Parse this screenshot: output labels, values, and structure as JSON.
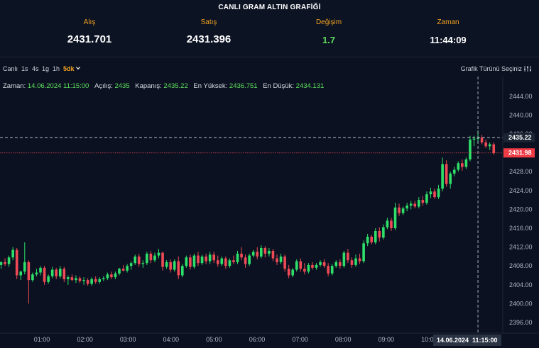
{
  "header": {
    "title": "CANLI GRAM ALTIN GRAFİĞİ",
    "stats": [
      {
        "label": "Alış",
        "value": "2431.701"
      },
      {
        "label": "Satış",
        "value": "2431.396"
      },
      {
        "label": "Değişim",
        "value": "1.7"
      },
      {
        "label": "Zaman",
        "value": "11:44:09"
      }
    ]
  },
  "toolbar": {
    "intervals": [
      "Canlı",
      "1s",
      "4s",
      "1g",
      "1h",
      "5dk"
    ],
    "active_interval": "5dk",
    "chart_type_label": "Grafik Türünü Seçiniz"
  },
  "ohlc_info": {
    "time_label": "Zaman:",
    "time_value": "14.06.2024 11:15:00",
    "open_label": "Açılış:",
    "open_value": "2435",
    "close_label": "Kapanış:",
    "close_value": "2435.22",
    "high_label": "En Yüksek:",
    "high_value": "2436.751",
    "low_label": "En Düşük:",
    "low_value": "2434.131"
  },
  "crosshair": {
    "price_label": "2435.22",
    "time_label": "11:15:00",
    "date_label": "14.06.2024"
  },
  "last_price_label": "2431.98",
  "colors": {
    "up": "#2ee06a",
    "down": "#ef4a56",
    "accent": "#f0a020",
    "background": "#0b1120"
  },
  "chart_data": {
    "type": "candlestick",
    "y_ticks": [
      2396,
      2400,
      2404,
      2408,
      2412,
      2416,
      2420,
      2424,
      2428,
      2432,
      2436,
      2440,
      2444
    ],
    "ylim": [
      2395,
      2446
    ],
    "x_ticks": [
      "01:00",
      "02:00",
      "03:00",
      "04:00",
      "05:00",
      "06:00",
      "07:00",
      "08:00",
      "09:00",
      "10:00",
      "11:00"
    ],
    "grid": false,
    "candles": [
      [
        2408.2,
        2409.0,
        2407.4,
        2408.8
      ],
      [
        2408.8,
        2409.6,
        2408.0,
        2408.4
      ],
      [
        2408.4,
        2410.2,
        2407.8,
        2409.8
      ],
      [
        2409.8,
        2412.0,
        2409.2,
        2411.4
      ],
      [
        2411.4,
        2411.8,
        2405.2,
        2406.0
      ],
      [
        2406.0,
        2407.0,
        2405.0,
        2406.8
      ],
      [
        2406.8,
        2413.0,
        2406.2,
        2408.8
      ],
      [
        2408.8,
        2409.2,
        2400.0,
        2405.0
      ],
      [
        2405.0,
        2406.6,
        2404.6,
        2406.2
      ],
      [
        2406.2,
        2407.4,
        2405.8,
        2406.6
      ],
      [
        2406.6,
        2408.0,
        2406.0,
        2407.6
      ],
      [
        2407.6,
        2408.0,
        2404.0,
        2404.6
      ],
      [
        2404.6,
        2406.2,
        2404.2,
        2405.8
      ],
      [
        2405.8,
        2407.8,
        2405.4,
        2407.2
      ],
      [
        2407.2,
        2407.6,
        2405.2,
        2405.8
      ],
      [
        2405.8,
        2408.0,
        2405.4,
        2407.4
      ],
      [
        2407.4,
        2407.8,
        2404.6,
        2405.2
      ],
      [
        2405.2,
        2406.0,
        2404.0,
        2405.6
      ],
      [
        2405.6,
        2406.2,
        2404.8,
        2405.0
      ],
      [
        2405.0,
        2406.0,
        2404.4,
        2405.4
      ],
      [
        2405.4,
        2405.8,
        2404.4,
        2404.8
      ],
      [
        2404.8,
        2405.6,
        2404.0,
        2405.0
      ],
      [
        2405.0,
        2405.4,
        2403.8,
        2404.2
      ],
      [
        2404.2,
        2405.6,
        2403.8,
        2405.2
      ],
      [
        2405.2,
        2405.8,
        2404.2,
        2404.6
      ],
      [
        2404.6,
        2405.6,
        2404.2,
        2405.2
      ],
      [
        2405.2,
        2405.8,
        2404.8,
        2405.4
      ],
      [
        2405.4,
        2406.6,
        2405.0,
        2406.2
      ],
      [
        2406.2,
        2406.8,
        2405.2,
        2405.6
      ],
      [
        2405.6,
        2406.8,
        2405.2,
        2406.4
      ],
      [
        2406.4,
        2407.6,
        2406.0,
        2407.4
      ],
      [
        2407.4,
        2408.2,
        2406.8,
        2407.0
      ],
      [
        2407.0,
        2408.4,
        2406.6,
        2408.0
      ],
      [
        2408.0,
        2409.0,
        2407.2,
        2408.6
      ],
      [
        2408.6,
        2410.4,
        2408.2,
        2410.0
      ],
      [
        2410.0,
        2410.6,
        2407.8,
        2408.4
      ],
      [
        2408.4,
        2409.2,
        2407.6,
        2408.6
      ],
      [
        2408.6,
        2411.0,
        2408.2,
        2410.6
      ],
      [
        2410.6,
        2411.2,
        2408.6,
        2409.2
      ],
      [
        2409.2,
        2410.8,
        2408.8,
        2410.2
      ],
      [
        2410.2,
        2411.6,
        2409.6,
        2410.8
      ],
      [
        2410.8,
        2411.0,
        2407.0,
        2407.8
      ],
      [
        2407.8,
        2409.2,
        2407.4,
        2408.8
      ],
      [
        2408.8,
        2409.4,
        2406.6,
        2407.2
      ],
      [
        2407.2,
        2409.4,
        2406.8,
        2409.0
      ],
      [
        2409.0,
        2410.0,
        2405.2,
        2406.0
      ],
      [
        2406.0,
        2408.4,
        2405.6,
        2408.0
      ],
      [
        2408.0,
        2410.2,
        2407.6,
        2409.8
      ],
      [
        2409.8,
        2410.4,
        2407.2,
        2407.8
      ],
      [
        2407.8,
        2410.6,
        2407.4,
        2410.2
      ],
      [
        2410.2,
        2411.0,
        2408.0,
        2408.6
      ],
      [
        2408.6,
        2410.4,
        2408.2,
        2410.0
      ],
      [
        2410.0,
        2410.6,
        2408.4,
        2409.0
      ],
      [
        2409.0,
        2411.0,
        2408.4,
        2410.4
      ],
      [
        2410.4,
        2411.0,
        2408.6,
        2409.2
      ],
      [
        2409.2,
        2410.2,
        2407.8,
        2408.4
      ],
      [
        2408.4,
        2410.0,
        2408.0,
        2409.6
      ],
      [
        2409.6,
        2410.0,
        2407.4,
        2408.0
      ],
      [
        2408.0,
        2409.6,
        2407.6,
        2409.2
      ],
      [
        2409.2,
        2410.2,
        2408.4,
        2408.8
      ],
      [
        2408.8,
        2411.2,
        2408.4,
        2410.6
      ],
      [
        2410.6,
        2412.0,
        2409.2,
        2409.8
      ],
      [
        2409.8,
        2410.4,
        2407.6,
        2408.4
      ],
      [
        2408.4,
        2410.6,
        2408.0,
        2410.2
      ],
      [
        2410.2,
        2411.4,
        2409.8,
        2411.0
      ],
      [
        2411.0,
        2412.0,
        2409.4,
        2410.0
      ],
      [
        2410.0,
        2412.4,
        2409.6,
        2411.8
      ],
      [
        2411.8,
        2412.2,
        2409.8,
        2410.6
      ],
      [
        2410.6,
        2411.8,
        2410.0,
        2411.2
      ],
      [
        2411.2,
        2411.6,
        2409.0,
        2409.6
      ],
      [
        2409.6,
        2410.4,
        2408.2,
        2408.8
      ],
      [
        2408.8,
        2410.6,
        2408.4,
        2410.0
      ],
      [
        2410.0,
        2410.4,
        2406.8,
        2407.4
      ],
      [
        2407.4,
        2408.2,
        2405.4,
        2406.0
      ],
      [
        2406.0,
        2407.6,
        2405.6,
        2407.2
      ],
      [
        2407.2,
        2409.4,
        2406.8,
        2409.0
      ],
      [
        2409.0,
        2409.6,
        2406.8,
        2407.4
      ],
      [
        2407.4,
        2408.6,
        2406.2,
        2406.8
      ],
      [
        2406.8,
        2408.6,
        2406.4,
        2408.2
      ],
      [
        2408.2,
        2408.8,
        2407.2,
        2407.6
      ],
      [
        2407.6,
        2408.6,
        2407.2,
        2408.2
      ],
      [
        2408.2,
        2409.2,
        2407.8,
        2408.8
      ],
      [
        2408.8,
        2409.4,
        2407.6,
        2408.0
      ],
      [
        2408.0,
        2408.6,
        2405.8,
        2406.4
      ],
      [
        2406.4,
        2408.4,
        2406.0,
        2408.0
      ],
      [
        2408.0,
        2409.2,
        2407.6,
        2408.8
      ],
      [
        2408.8,
        2409.4,
        2407.4,
        2408.0
      ],
      [
        2408.0,
        2411.2,
        2407.6,
        2410.8
      ],
      [
        2410.8,
        2411.6,
        2408.6,
        2409.2
      ],
      [
        2409.2,
        2409.8,
        2407.6,
        2408.2
      ],
      [
        2408.2,
        2410.4,
        2407.8,
        2409.6
      ],
      [
        2409.6,
        2410.6,
        2408.4,
        2409.0
      ],
      [
        2409.0,
        2413.4,
        2408.6,
        2412.8
      ],
      [
        2412.8,
        2414.8,
        2412.2,
        2414.2
      ],
      [
        2414.2,
        2414.6,
        2412.6,
        2413.0
      ],
      [
        2413.0,
        2416.0,
        2412.6,
        2415.4
      ],
      [
        2415.4,
        2416.2,
        2413.2,
        2414.0
      ],
      [
        2414.0,
        2416.8,
        2413.6,
        2416.2
      ],
      [
        2416.2,
        2418.2,
        2415.8,
        2417.6
      ],
      [
        2417.6,
        2418.2,
        2415.4,
        2416.0
      ],
      [
        2416.0,
        2421.4,
        2415.6,
        2420.4
      ],
      [
        2420.4,
        2421.2,
        2418.6,
        2419.2
      ],
      [
        2419.2,
        2420.6,
        2418.8,
        2420.2
      ],
      [
        2420.2,
        2421.4,
        2419.6,
        2420.8
      ],
      [
        2420.8,
        2421.8,
        2420.0,
        2421.2
      ],
      [
        2421.2,
        2421.8,
        2420.2,
        2420.6
      ],
      [
        2420.6,
        2422.6,
        2420.2,
        2422.0
      ],
      [
        2422.0,
        2422.8,
        2420.8,
        2421.4
      ],
      [
        2421.4,
        2423.8,
        2421.0,
        2423.2
      ],
      [
        2423.2,
        2424.6,
        2422.4,
        2423.8
      ],
      [
        2423.8,
        2424.4,
        2422.2,
        2422.6
      ],
      [
        2422.6,
        2425.2,
        2422.2,
        2424.4
      ],
      [
        2424.4,
        2431.0,
        2423.8,
        2429.6
      ],
      [
        2429.6,
        2430.4,
        2424.8,
        2425.4
      ],
      [
        2425.4,
        2428.0,
        2424.4,
        2427.6
      ],
      [
        2427.6,
        2429.0,
        2427.0,
        2428.4
      ],
      [
        2428.4,
        2430.2,
        2428.0,
        2429.8
      ],
      [
        2429.8,
        2430.6,
        2428.2,
        2429.0
      ],
      [
        2429.0,
        2431.0,
        2428.6,
        2430.6
      ],
      [
        2430.6,
        2435.6,
        2430.2,
        2434.8
      ],
      [
        2434.8,
        2435.6,
        2433.4,
        2435.0
      ],
      [
        2435.0,
        2436.751,
        2434.131,
        2435.22
      ],
      [
        2435.22,
        2435.8,
        2433.8,
        2434.2
      ],
      [
        2434.2,
        2434.8,
        2433.0,
        2433.4
      ],
      [
        2433.4,
        2434.2,
        2432.6,
        2433.8
      ],
      [
        2433.8,
        2434.2,
        2431.6,
        2431.98
      ]
    ]
  }
}
